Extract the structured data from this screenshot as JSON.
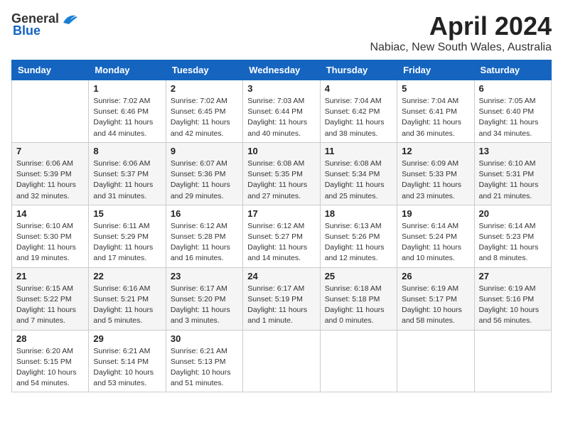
{
  "header": {
    "logo_general": "General",
    "logo_blue": "Blue",
    "month": "April 2024",
    "location": "Nabiac, New South Wales, Australia"
  },
  "weekdays": [
    "Sunday",
    "Monday",
    "Tuesday",
    "Wednesday",
    "Thursday",
    "Friday",
    "Saturday"
  ],
  "weeks": [
    [
      {
        "day": "",
        "info": ""
      },
      {
        "day": "1",
        "info": "Sunrise: 7:02 AM\nSunset: 6:46 PM\nDaylight: 11 hours\nand 44 minutes."
      },
      {
        "day": "2",
        "info": "Sunrise: 7:02 AM\nSunset: 6:45 PM\nDaylight: 11 hours\nand 42 minutes."
      },
      {
        "day": "3",
        "info": "Sunrise: 7:03 AM\nSunset: 6:44 PM\nDaylight: 11 hours\nand 40 minutes."
      },
      {
        "day": "4",
        "info": "Sunrise: 7:04 AM\nSunset: 6:42 PM\nDaylight: 11 hours\nand 38 minutes."
      },
      {
        "day": "5",
        "info": "Sunrise: 7:04 AM\nSunset: 6:41 PM\nDaylight: 11 hours\nand 36 minutes."
      },
      {
        "day": "6",
        "info": "Sunrise: 7:05 AM\nSunset: 6:40 PM\nDaylight: 11 hours\nand 34 minutes."
      }
    ],
    [
      {
        "day": "7",
        "info": "Sunrise: 6:06 AM\nSunset: 5:39 PM\nDaylight: 11 hours\nand 32 minutes."
      },
      {
        "day": "8",
        "info": "Sunrise: 6:06 AM\nSunset: 5:37 PM\nDaylight: 11 hours\nand 31 minutes."
      },
      {
        "day": "9",
        "info": "Sunrise: 6:07 AM\nSunset: 5:36 PM\nDaylight: 11 hours\nand 29 minutes."
      },
      {
        "day": "10",
        "info": "Sunrise: 6:08 AM\nSunset: 5:35 PM\nDaylight: 11 hours\nand 27 minutes."
      },
      {
        "day": "11",
        "info": "Sunrise: 6:08 AM\nSunset: 5:34 PM\nDaylight: 11 hours\nand 25 minutes."
      },
      {
        "day": "12",
        "info": "Sunrise: 6:09 AM\nSunset: 5:33 PM\nDaylight: 11 hours\nand 23 minutes."
      },
      {
        "day": "13",
        "info": "Sunrise: 6:10 AM\nSunset: 5:31 PM\nDaylight: 11 hours\nand 21 minutes."
      }
    ],
    [
      {
        "day": "14",
        "info": "Sunrise: 6:10 AM\nSunset: 5:30 PM\nDaylight: 11 hours\nand 19 minutes."
      },
      {
        "day": "15",
        "info": "Sunrise: 6:11 AM\nSunset: 5:29 PM\nDaylight: 11 hours\nand 17 minutes."
      },
      {
        "day": "16",
        "info": "Sunrise: 6:12 AM\nSunset: 5:28 PM\nDaylight: 11 hours\nand 16 minutes."
      },
      {
        "day": "17",
        "info": "Sunrise: 6:12 AM\nSunset: 5:27 PM\nDaylight: 11 hours\nand 14 minutes."
      },
      {
        "day": "18",
        "info": "Sunrise: 6:13 AM\nSunset: 5:26 PM\nDaylight: 11 hours\nand 12 minutes."
      },
      {
        "day": "19",
        "info": "Sunrise: 6:14 AM\nSunset: 5:24 PM\nDaylight: 11 hours\nand 10 minutes."
      },
      {
        "day": "20",
        "info": "Sunrise: 6:14 AM\nSunset: 5:23 PM\nDaylight: 11 hours\nand 8 minutes."
      }
    ],
    [
      {
        "day": "21",
        "info": "Sunrise: 6:15 AM\nSunset: 5:22 PM\nDaylight: 11 hours\nand 7 minutes."
      },
      {
        "day": "22",
        "info": "Sunrise: 6:16 AM\nSunset: 5:21 PM\nDaylight: 11 hours\nand 5 minutes."
      },
      {
        "day": "23",
        "info": "Sunrise: 6:17 AM\nSunset: 5:20 PM\nDaylight: 11 hours\nand 3 minutes."
      },
      {
        "day": "24",
        "info": "Sunrise: 6:17 AM\nSunset: 5:19 PM\nDaylight: 11 hours\nand 1 minute."
      },
      {
        "day": "25",
        "info": "Sunrise: 6:18 AM\nSunset: 5:18 PM\nDaylight: 11 hours\nand 0 minutes."
      },
      {
        "day": "26",
        "info": "Sunrise: 6:19 AM\nSunset: 5:17 PM\nDaylight: 10 hours\nand 58 minutes."
      },
      {
        "day": "27",
        "info": "Sunrise: 6:19 AM\nSunset: 5:16 PM\nDaylight: 10 hours\nand 56 minutes."
      }
    ],
    [
      {
        "day": "28",
        "info": "Sunrise: 6:20 AM\nSunset: 5:15 PM\nDaylight: 10 hours\nand 54 minutes."
      },
      {
        "day": "29",
        "info": "Sunrise: 6:21 AM\nSunset: 5:14 PM\nDaylight: 10 hours\nand 53 minutes."
      },
      {
        "day": "30",
        "info": "Sunrise: 6:21 AM\nSunset: 5:13 PM\nDaylight: 10 hours\nand 51 minutes."
      },
      {
        "day": "",
        "info": ""
      },
      {
        "day": "",
        "info": ""
      },
      {
        "day": "",
        "info": ""
      },
      {
        "day": "",
        "info": ""
      }
    ]
  ]
}
